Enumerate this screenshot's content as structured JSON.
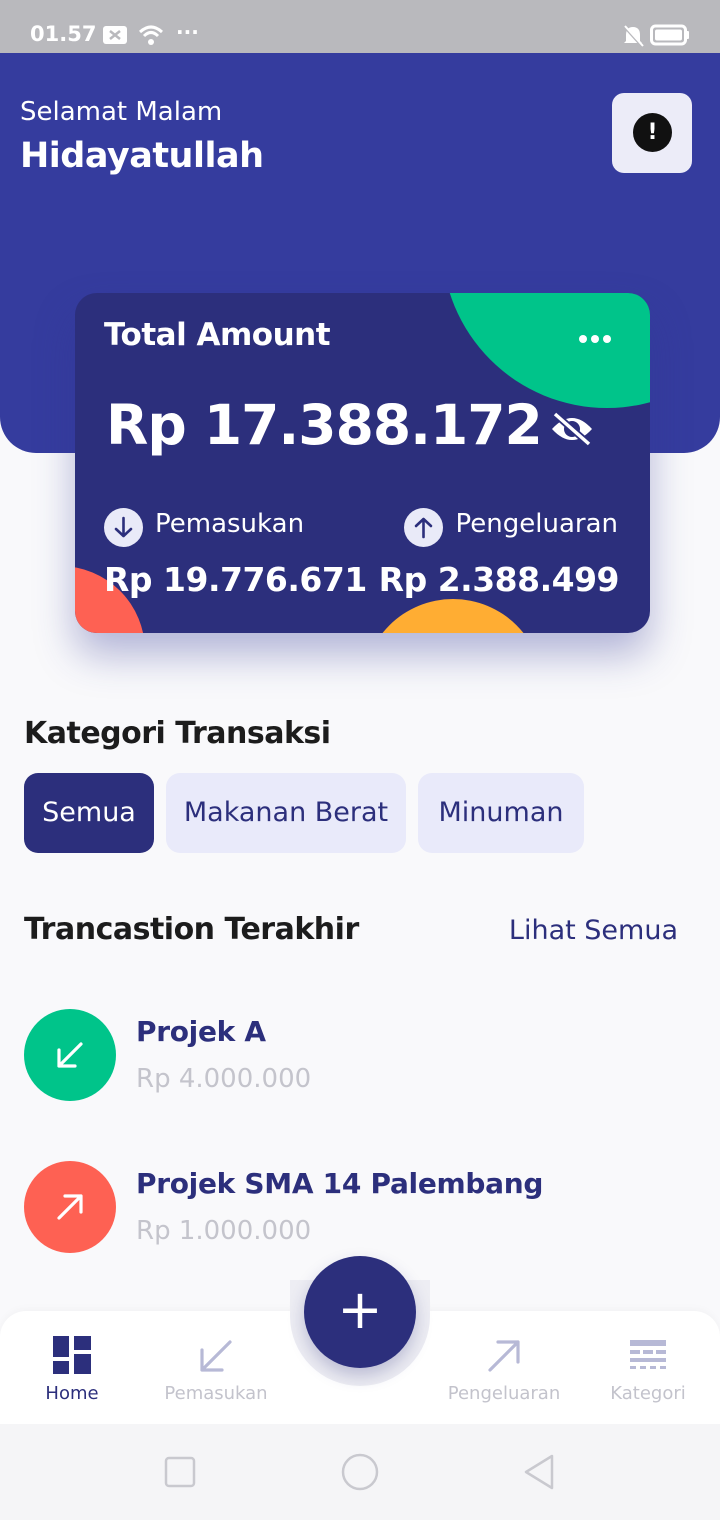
{
  "status_bar": {
    "time": "01.57",
    "more": "···"
  },
  "header": {
    "greeting": "Selamat Malam",
    "username": "Hidayatullah"
  },
  "card": {
    "title": "Total Amount",
    "total": "Rp 17.388.172",
    "income_label": "Pemasukan",
    "income_amount": "Rp 19.776.671",
    "expense_label": "Pengeluaran",
    "expense_amount": "Rp 2.388.499"
  },
  "categories": {
    "title": "Kategori Transaksi",
    "items": [
      {
        "label": "Semua",
        "active": true
      },
      {
        "label": "Makanan Berat",
        "active": false
      },
      {
        "label": "Minuman",
        "active": false
      }
    ]
  },
  "transactions": {
    "title": "Trancastion Terakhir",
    "see_all": "Lihat Semua",
    "items": [
      {
        "name": "Projek A",
        "amount": "Rp 4.000.000",
        "type": "income",
        "color": "#00c48a"
      },
      {
        "name": "Projek SMA 14 Palembang",
        "amount": "Rp 1.000.000",
        "type": "expense",
        "color": "#fe6153"
      }
    ]
  },
  "bottom_nav": {
    "items": [
      {
        "label": "Home",
        "icon": "grid-icon",
        "active": true
      },
      {
        "label": "Pemasukan",
        "icon": "arrow-down-left-icon",
        "active": false
      },
      {
        "label": "Pengeluaran",
        "icon": "arrow-up-right-icon",
        "active": false
      },
      {
        "label": "Kategori",
        "icon": "category-icon",
        "active": false
      }
    ],
    "fab_label": "+"
  },
  "colors": {
    "primary": "#353c9e",
    "card": "#2c2f7c",
    "income": "#00c48a",
    "expense": "#fe6153",
    "accent_orange": "#ffad33"
  }
}
